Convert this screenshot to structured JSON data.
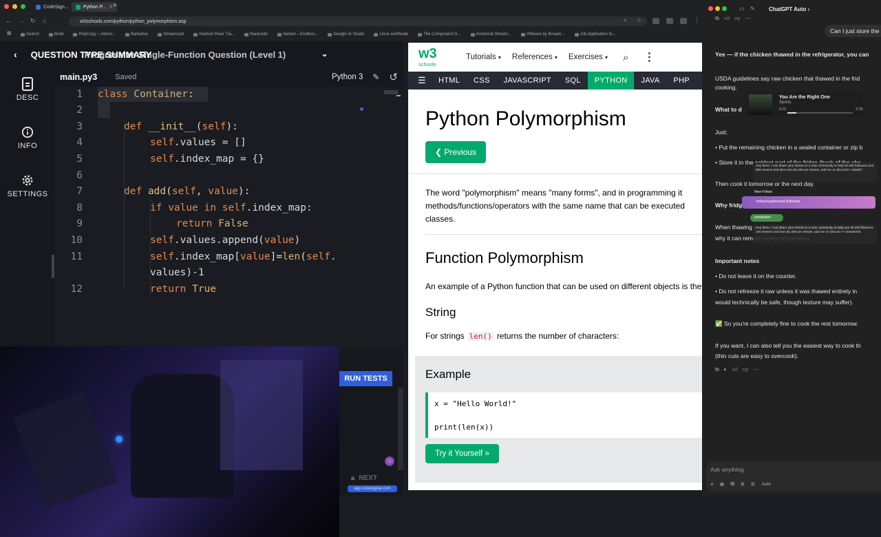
{
  "browser": {
    "tabs": [
      {
        "label": "CodeSign..."
      },
      {
        "label": "Python P..."
      }
    ],
    "url": "w3schools.com/python/python_polymorphism.asp",
    "bookmarks": [
      "Search",
      "Build",
      "PolyCopy – Aiimor...",
      "Barkative",
      "Streamcast",
      "Hudson River Tra...",
      "Nautcode",
      "Variant – Endless...",
      "Google AI Studio",
      "Linux certificate",
      "The Component G...",
      "Aristocrat Stream...",
      "VMware by Broadc...",
      "Job Application fo..."
    ]
  },
  "codesignal": {
    "header_title": "QUESTION TYPE SUMMARY",
    "header_subtitle": "Progressive Single-Function Question (Level 1)",
    "sidebar": [
      {
        "label": "DESC"
      },
      {
        "label": "INFO"
      },
      {
        "label": "SETTINGS"
      }
    ],
    "file_name": "main.py3",
    "save_status": "Saved",
    "language": "Python 3",
    "line_numbers": [
      "1",
      "2",
      "3",
      "4",
      "5",
      "6",
      "7",
      "8",
      "9",
      "10",
      "11",
      "12"
    ],
    "run_tests_label": "RUN TESTS",
    "next_label": "NEXT",
    "footer_url": "app.codesignal.com"
  },
  "w3schools": {
    "logo_text": "w3",
    "logo_sub": "schools",
    "nav": [
      "Tutorials",
      "References",
      "Exercises"
    ],
    "subnav": [
      "HTML",
      "CSS",
      "JAVASCRIPT",
      "SQL",
      "PYTHON",
      "JAVA",
      "PHP"
    ],
    "page_title": "Python Polymorphism",
    "previous_label": "❮ Previous",
    "intro_line1": "The word \"polymorphism\" means \"many forms\", and in programming it",
    "intro_line2": "methods/functions/operators with the same name that can be executed",
    "intro_line3": "classes.",
    "section_title": "Function Polymorphism",
    "section_text": "An example of a Python function that can be used on different objects is the",
    "string_title": "String",
    "string_text_before": "For strings",
    "string_code": "len()",
    "string_text_after": "returns the number of characters:",
    "example_title": "Example",
    "example_line1": "x = \"Hello World!\"",
    "example_line2": "print(len(x))",
    "try_label": "Try it Yourself »"
  },
  "chatgpt": {
    "title": "ChatGPT Auto ›",
    "user_message": "Can I just store the",
    "lines": [
      {
        "text": "Yes — if the chicken thawed in the refrigerator, you can",
        "bold": true
      },
      {
        "text": "USDA guidelines say raw chicken that thawed in the frid",
        "bold": false
      },
      {
        "text": "cooking.",
        "bold": false
      },
      {
        "text": "What to d",
        "bold": true
      },
      {
        "text": "Just:",
        "bold": false
      },
      {
        "text": "• Put the remaining chicken in a sealed container or zip b",
        "bold": false
      },
      {
        "text": "• Store it in the coldest part of the fridge (back of the she",
        "bold": false
      },
      {
        "text": "Then cook it tomorrow or the next day.",
        "bold": false
      },
      {
        "text": "Why fridg",
        "bold": true
      },
      {
        "text": "When thawing in the fridge, the chicken stays below 40°F",
        "bold": false
      },
      {
        "text": "why it can remain safely refrigerated.",
        "bold": false
      },
      {
        "text": "Important notes",
        "bold": true
      },
      {
        "text": "• Do not leave it on the counter.",
        "bold": false
      },
      {
        "text": "• Do not refreeze it raw unless it was thawed entirely in",
        "bold": false
      },
      {
        "text": "  would technically be safe, though texture may suffer).",
        "bold": false
      },
      {
        "text": "✅ So you're completely fine to cook the rest tomorrow.",
        "bold": false
      },
      {
        "text": "If you want, I can also tell you the easiest way to cook th",
        "bold": false
      },
      {
        "text": "(thin cuts are easy to overcook).",
        "bold": false
      }
    ],
    "input_placeholder": "Ask anything",
    "auto_label": "Auto",
    "overlay_music_title": "You Are the Right One",
    "overlay_music_sub": "Sports",
    "overlay_music_time_start": "0:23",
    "overlay_music_time_end": "-2:29",
    "overlay_stream_text": "Hey there, I can share your stream in a new community to help hit 200 followers and 800 viewers and also earn $1,500 per stream, add me on discord>> ciky857",
    "overlay_newfollow": "New Follow",
    "overlay_followed": "mrbuzzupdemont followed",
    "overlay_user": "ismiledein",
    "overlay_stream_text2": "Hey there, I can share your stream in a new community to help you hit 200 followers 100 viewers and earn $1,500 per stream, add me on discord >> smedies01"
  }
}
